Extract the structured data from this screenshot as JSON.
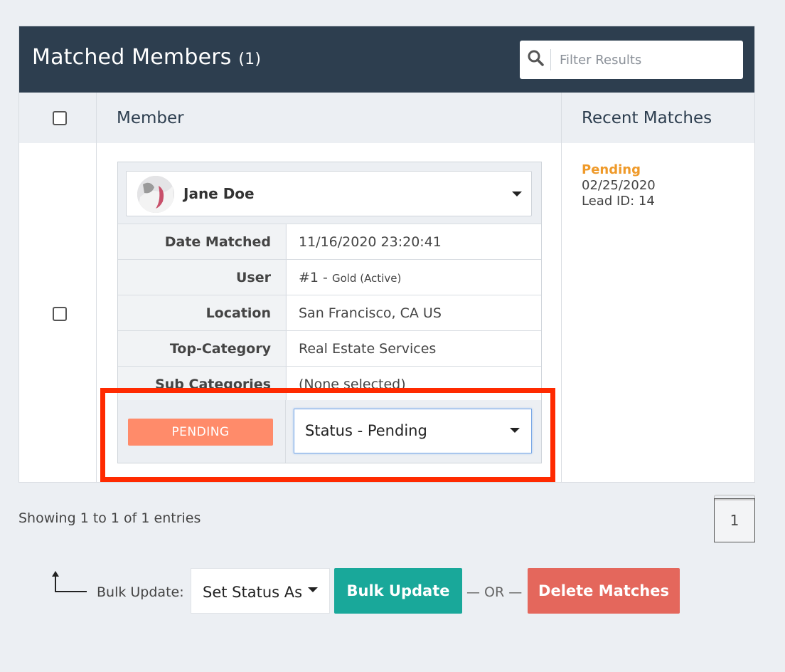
{
  "panel": {
    "title": "Matched Members",
    "count": "(1)",
    "filter_placeholder": "Filter Results"
  },
  "table": {
    "columns": [
      "Member",
      "Recent Matches"
    ]
  },
  "member": {
    "name": "Jane Doe",
    "details": [
      {
        "label": "Date Matched",
        "value": "11/16/2020 23:20:41",
        "note": ""
      },
      {
        "label": "User",
        "value": "#1 - ",
        "note": "Gold (Active)"
      },
      {
        "label": "Location",
        "value": "San Francisco, CA US",
        "note": ""
      },
      {
        "label": "Top-Category",
        "value": "Real Estate Services",
        "note": ""
      },
      {
        "label": "Sub Categories",
        "value": "(None selected)",
        "note": ""
      }
    ],
    "status_badge": "PENDING",
    "status_select": "Status - Pending"
  },
  "recent_matches": {
    "status": "Pending",
    "date": "02/25/2020",
    "lead": "Lead ID: 14"
  },
  "footer": {
    "showing": "Showing 1 to 1 of 1 entries",
    "page": "1",
    "bulk_label": "Bulk Update:",
    "set_status": "Set Status As",
    "bulk_button": "Bulk Update",
    "or_text": "— OR —",
    "delete_button": "Delete Matches"
  },
  "colors": {
    "header_bg": "#2d3e4f",
    "pending_badge": "#ff8b6a",
    "pending_text": "#ef9a2a",
    "bulk_button": "#19a89a",
    "delete_button": "#e4675c",
    "highlight": "#ff2a00"
  },
  "icons": {
    "search": "search-icon",
    "dropdown": "caret-down-icon",
    "arrow": "corner-up-arrow-icon"
  }
}
